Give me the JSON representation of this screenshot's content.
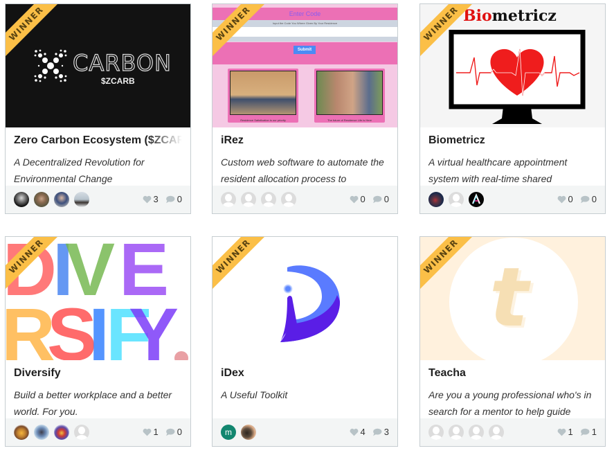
{
  "ribbon_label": "WINNER",
  "colors": {
    "ribbon": "#fbbf47",
    "card_border": "#c6cdd1",
    "footer_bg": "#f3f5f5",
    "icon_gray": "#b8c3c7"
  },
  "projects": [
    {
      "title": "Zero Carbon Ecosystem ($ZCARB)",
      "tagline": "A Decentralized Revolution for Environmental Change",
      "thumb": {
        "brand": "CARBON",
        "ticker": "$ZCARB"
      },
      "likes": "3",
      "comments": "0",
      "members": [
        "photo",
        "photo",
        "photo",
        "photo"
      ]
    },
    {
      "title": "iRez",
      "tagline": "Custom web software to automate the resident allocation process to",
      "thumb": {
        "heading": "Enter Code",
        "subheading": "Input the Code You Where Given By Your Residence",
        "button": "Submit",
        "caption_left": "Residence Satisfication is our priority",
        "caption_right": "The future of Residence Life is Here"
      },
      "likes": "0",
      "comments": "0",
      "members": [
        "default",
        "default",
        "default",
        "default"
      ]
    },
    {
      "title": "Biometricz",
      "tagline": "A virtual healthcare appointment system with real-time shared",
      "thumb": {
        "brand_red": "Bio",
        "brand_black": "metricz"
      },
      "likes": "0",
      "comments": "0",
      "members": [
        "photo",
        "default",
        "logo"
      ]
    },
    {
      "title": "Diversify",
      "tagline": "Build a better workplace and a better world. For you.",
      "thumb": {
        "word_top": "DIVE",
        "word_bottom": "RSIFY."
      },
      "likes": "1",
      "comments": "0",
      "members": [
        "photo",
        "photo",
        "photo",
        "default"
      ]
    },
    {
      "title": "iDex",
      "tagline": "A Useful Toolkit",
      "thumb": {},
      "likes": "4",
      "comments": "3",
      "members": [
        "m",
        "photo"
      ]
    },
    {
      "title": "Teacha",
      "tagline": "Are you a young professional who's in search for a mentor to help guide",
      "thumb": {
        "letter": "t"
      },
      "likes": "1",
      "comments": "1",
      "members": [
        "default",
        "default",
        "default",
        "default"
      ]
    }
  ]
}
